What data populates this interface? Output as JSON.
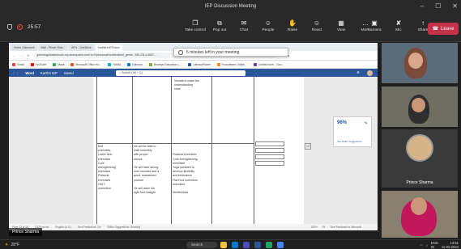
{
  "meeting": {
    "title": "IEP Discussion Meeting",
    "timer": "25:57",
    "tools": [
      {
        "icon": "Take control",
        "label": "Take control",
        "glyph": "❐"
      },
      {
        "icon": "Pop out",
        "label": "Pop out",
        "glyph": "⧉"
      },
      {
        "icon": "Chat",
        "label": "Chat",
        "glyph": "✉"
      },
      {
        "icon": "People",
        "label": "People",
        "glyph": "☺"
      },
      {
        "icon": "Raise",
        "label": "Raise",
        "glyph": "✋"
      },
      {
        "icon": "React",
        "label": "React",
        "glyph": "☺"
      },
      {
        "icon": "View",
        "label": "View",
        "glyph": "▦"
      },
      {
        "icon": "More",
        "label": "More",
        "glyph": "…"
      }
    ],
    "media": [
      {
        "label": "Camera",
        "glyph": "▣"
      },
      {
        "label": "Mic",
        "glyph": "✘"
      },
      {
        "label": "Share",
        "glyph": "↑"
      }
    ],
    "leave_label": "Leave",
    "presenter": "Prince Sharma"
  },
  "browser": {
    "tabs": [
      "Home | Microsoft",
      "Mail - Prince Shar...",
      "IEPs - OneDrive",
      "Karthik's IEP.docx"
    ],
    "url": "gemstoglobalschools-my.sharepoint.com/:w:/r/personal/rnutrienteed_gems...5f5-2314-4557...",
    "bookmarks": [
      "Gmail",
      "YouTube",
      "Maps",
      "Microsoft Office Ho...",
      "TickBa",
      "Edmodo",
      "Bhartiya Education L...",
      "LiteracyPlanet",
      "Focusflearn Online...",
      "Untitled form - Goo..."
    ]
  },
  "word": {
    "app": "Word",
    "doc": "Karth's IEP",
    "saved": "Saved",
    "search": "Search (Alt + Q)"
  },
  "toast": "5 minutes left in your meeting.",
  "editor": {
    "score": "96%",
    "suggestions": "See Editor suggestions"
  },
  "document": {
    "top_cell": "Visuals to make the\nunderstanding\nclear",
    "col1": "feet\nexercises,\nLower limb\nexercises\nCore\nstrengthening\nexercises\nPostural\nexercises\nGAIT\ncorrection",
    "col2": "He will be able to\nwalk smoothly\nwith proper\nstance.\n\nHe will have strong\ncore muscles and a\ngood, maintained\nposture\n\nHe will place his\nright foot straight",
    "col3": "\n\nPostural exercises\nCore strengthening\nexercises\nYoga postures to\ndevelop flexibility\nand endurance\nFlat Foot correction\nexercises\n\nMindfulness",
    "page_marker": "15"
  },
  "statusbar": {
    "page": "Page 13 of 18",
    "words": "2,525 words",
    "lang": "English (U.S.)",
    "text_predictions": "Text Predictions: On",
    "editor": "Editor Suggestions: Showing",
    "zoom": "100%",
    "fit": "Fit",
    "feedback": "Give Feedback to Microsoft"
  },
  "participants": [
    "",
    "",
    "Prince Sharma",
    ""
  ],
  "taskbar": {
    "weather": "28°F",
    "search": "Search",
    "lang": "ENG\nIN",
    "time": "13:51",
    "date": "11-02-2023"
  },
  "colors": {
    "teams_bg": "#1f1f1f",
    "word_blue": "#2b579a",
    "leave_red": "#c4314b"
  }
}
